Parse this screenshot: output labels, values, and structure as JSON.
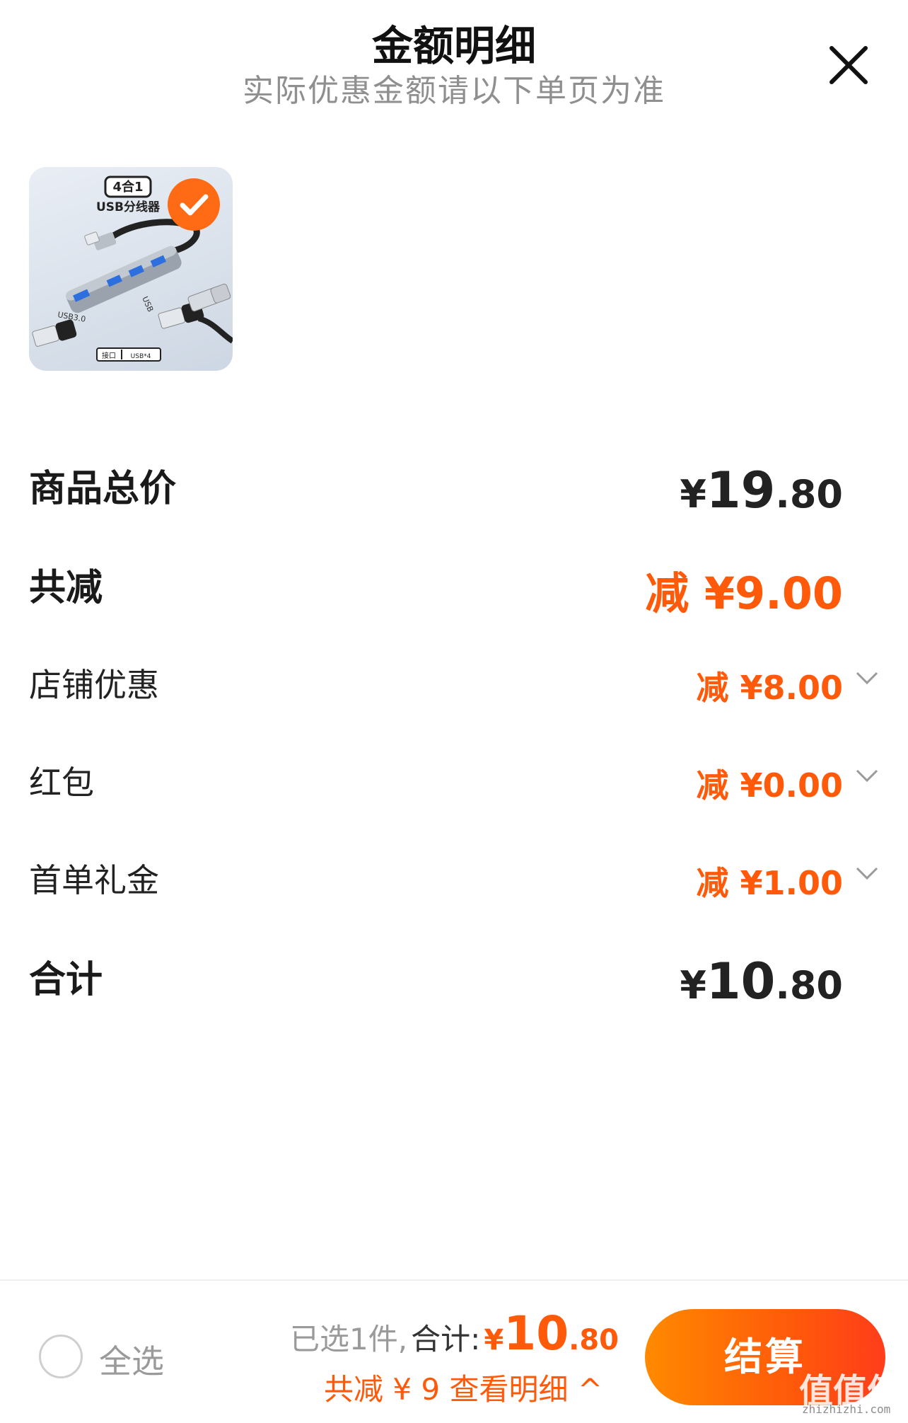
{
  "header": {
    "title": "金额明细",
    "subtitle": "实际优惠金额请以下单页为准"
  },
  "product": {
    "badge_text": "4合1",
    "name_text": "USB分线器",
    "port_label": "接口",
    "port_value": "USB*4",
    "usb_label": "USB",
    "usb3_label": "USB3.0",
    "selected": true
  },
  "rows": {
    "total_price": {
      "label": "商品总价",
      "currency": "¥",
      "int": "19",
      "dec": ".80"
    },
    "total_reduce": {
      "label": "共减",
      "amount": "减 ¥9.00"
    },
    "shop_discount": {
      "label": "店铺优惠",
      "amount": "减 ¥8.00"
    },
    "red_packet": {
      "label": "红包",
      "amount": "减 ¥0.00"
    },
    "first_order_gift": {
      "label": "首单礼金",
      "amount": "减 ¥1.00"
    },
    "subtotal": {
      "label": "合计",
      "currency": "¥",
      "int": "10",
      "dec": ".80"
    }
  },
  "footer": {
    "select_all_label": "全选",
    "selected_count_text": "已选1件,",
    "sum_label": "合计:",
    "currency": "¥",
    "sum_int": "10",
    "sum_dec": ".80",
    "reduce_link_text": "共减 ¥ 9  查看明细 ^",
    "checkout_label": "结算"
  },
  "watermark": {
    "text": "值值值",
    "url_text": "zhizhizhi.com"
  },
  "colors": {
    "accent": "#ff5a0a",
    "checkout_gradient_start": "#ff8a00",
    "checkout_gradient_end": "#ff3d1a",
    "muted_text": "#8f8f8f"
  },
  "icons": [
    "close-icon",
    "check-icon",
    "chevron-down-icon",
    "chevron-up-icon",
    "radio-empty-icon"
  ]
}
